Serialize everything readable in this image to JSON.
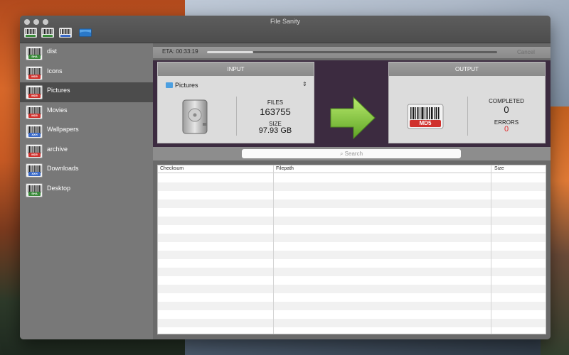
{
  "window": {
    "title": "File Sanity"
  },
  "toolbar": {
    "icons": [
      {
        "name": "barcode-sha-icon",
        "tag_color": "#3a8a3a"
      },
      {
        "name": "barcode-sha-icon",
        "tag_color": "#3a8a3a"
      },
      {
        "name": "barcode-xxh-icon",
        "tag_color": "#3a6ac8"
      },
      {
        "name": "screen-icon",
        "tag_color": "#2a78c8"
      }
    ]
  },
  "sidebar": {
    "items": [
      {
        "label": "dist",
        "tag": "SHA",
        "tag_color": "#3a8a3a"
      },
      {
        "label": "Icons",
        "tag": "MD5",
        "tag_color": "#d0312d"
      },
      {
        "label": "Pictures",
        "tag": "MD5",
        "tag_color": "#d0312d",
        "selected": true
      },
      {
        "label": "Movies",
        "tag": "MD5",
        "tag_color": "#d0312d"
      },
      {
        "label": "Wallpapers",
        "tag": "XXH",
        "tag_color": "#3a6ac8"
      },
      {
        "label": "archive",
        "tag": "MD5",
        "tag_color": "#d0312d"
      },
      {
        "label": "Downloads",
        "tag": "XXH",
        "tag_color": "#3a6ac8"
      },
      {
        "label": "Desktop",
        "tag": "SHA",
        "tag_color": "#3a8a3a"
      }
    ]
  },
  "eta": {
    "label": "ETA: 00:33:19",
    "progress": 0.16,
    "cancel_label": "Cancel"
  },
  "input": {
    "header": "INPUT",
    "source": "Pictures",
    "files_label": "FILES",
    "files_value": "163755",
    "size_label": "SIZE",
    "size_value": "97.93 GB"
  },
  "output": {
    "header": "OUTPUT",
    "badge": "MD5",
    "completed_label": "COMPLETED",
    "completed_value": "0",
    "errors_label": "ERRORS",
    "errors_value": "0",
    "errors_color": "#e02a2a"
  },
  "search": {
    "placeholder": "Search"
  },
  "table": {
    "columns": [
      "Checksum",
      "Filepath",
      "Size"
    ],
    "rows": []
  },
  "colors": {
    "accent_arrow": "#7fc436",
    "stage_bg": "#3c2b40"
  }
}
